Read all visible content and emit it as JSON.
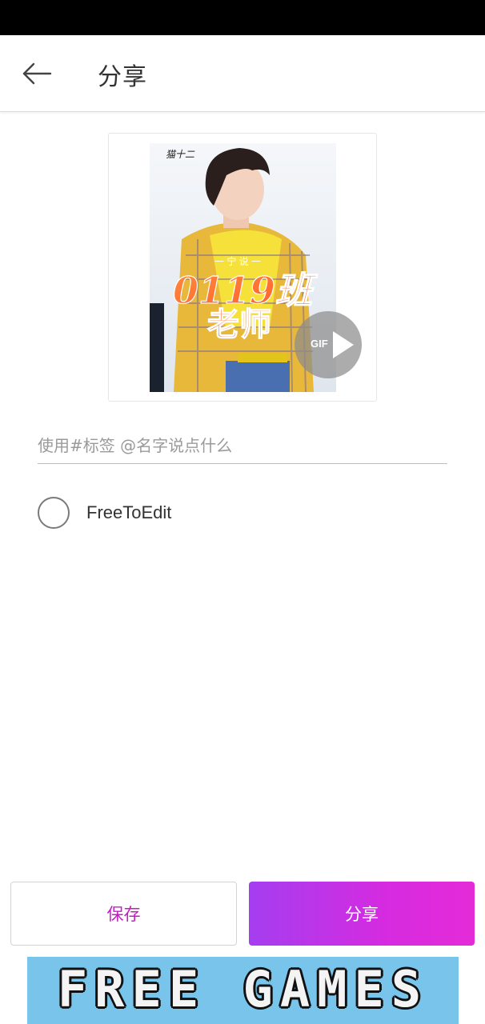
{
  "header": {
    "title": "分享",
    "back_icon": "arrow-left-icon"
  },
  "preview": {
    "badge_label": "GIF",
    "overlay_text_top": "一 宁 说 一",
    "overlay_text_main": "0119班",
    "overlay_text_sub": "老师",
    "signature": "猫十二"
  },
  "caption": {
    "placeholder": "使用#标签 @名字说点什么",
    "value": ""
  },
  "free_to_edit": {
    "label": "FreeToEdit",
    "checked": false
  },
  "actions": {
    "save_label": "保存",
    "share_label": "分享",
    "save_color": "#c41cc4",
    "share_gradient_start": "#a53ef0",
    "share_gradient_end": "#e52bd8"
  },
  "ad": {
    "text": "FREE GAMES",
    "background": "#79c4ea"
  }
}
